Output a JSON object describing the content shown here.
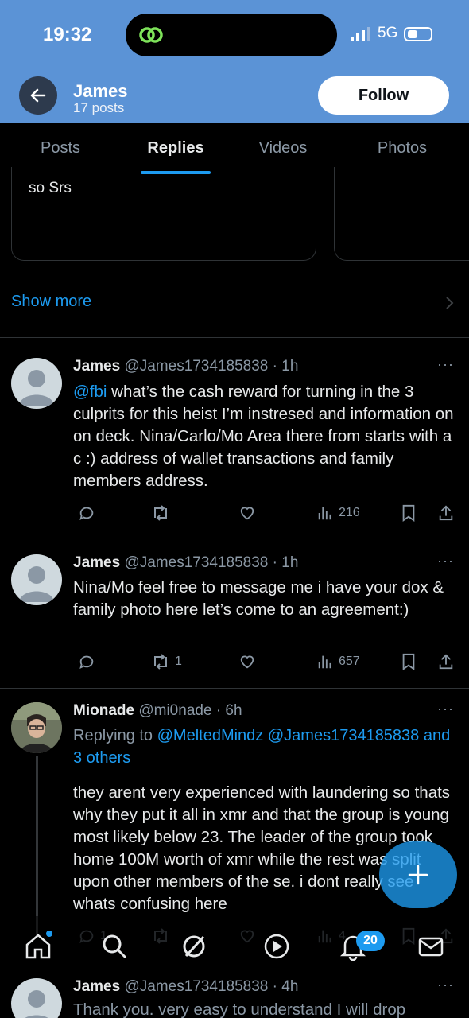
{
  "status_bar": {
    "time": "19:32",
    "network": "5G"
  },
  "header": {
    "name": "James",
    "posts": "17 posts",
    "follow_label": "Follow"
  },
  "tabs": [
    {
      "label": "Posts"
    },
    {
      "label": "Replies"
    },
    {
      "label": "Videos"
    },
    {
      "label": "Photos"
    }
  ],
  "active_tab": "Replies",
  "card": {
    "text": "so Srs"
  },
  "show_more": "Show more",
  "tweets": [
    {
      "name": "James",
      "handle": "@James1734185838 · 1h",
      "mention": "@fbi",
      "text": " what’s the cash reward for turning in the 3 culprits for this heist I’m instresed and information on on deck. Nina/Carlo/Mo Area there from starts with a c :) address of wallet transactions and family members address.",
      "reposts": "",
      "views": "216"
    },
    {
      "name": "James",
      "handle": "@James1734185838 · 1h",
      "text": "Nina/Mo feel free to message me i have your dox & family photo here let’s come to an agreement:)",
      "reposts": "1",
      "views": "657"
    },
    {
      "name": "Mionade",
      "handle": "@mi0nade · 6h",
      "replying_prefix": "Replying to ",
      "replying_to": "@MeltedMindz @James1734185838 and 3 others",
      "text": "they arent very experienced with laundering so thats why they put it all in xmr and that the group is young most likely below 23. The leader of the group took home 100M worth of xmr while the rest was split upon other members of the se. i dont really see whats confusing here",
      "replies": "1",
      "views": "4"
    },
    {
      "name": "James",
      "handle": "@James1734185838 · 4h",
      "text": "Thank you. very easy to understand I will drop"
    }
  ],
  "bottom_nav": {
    "notifications_badge": "20"
  },
  "colors": {
    "accent": "#1d9bf0",
    "header_bg": "#5b93d6",
    "background": "#000000"
  }
}
